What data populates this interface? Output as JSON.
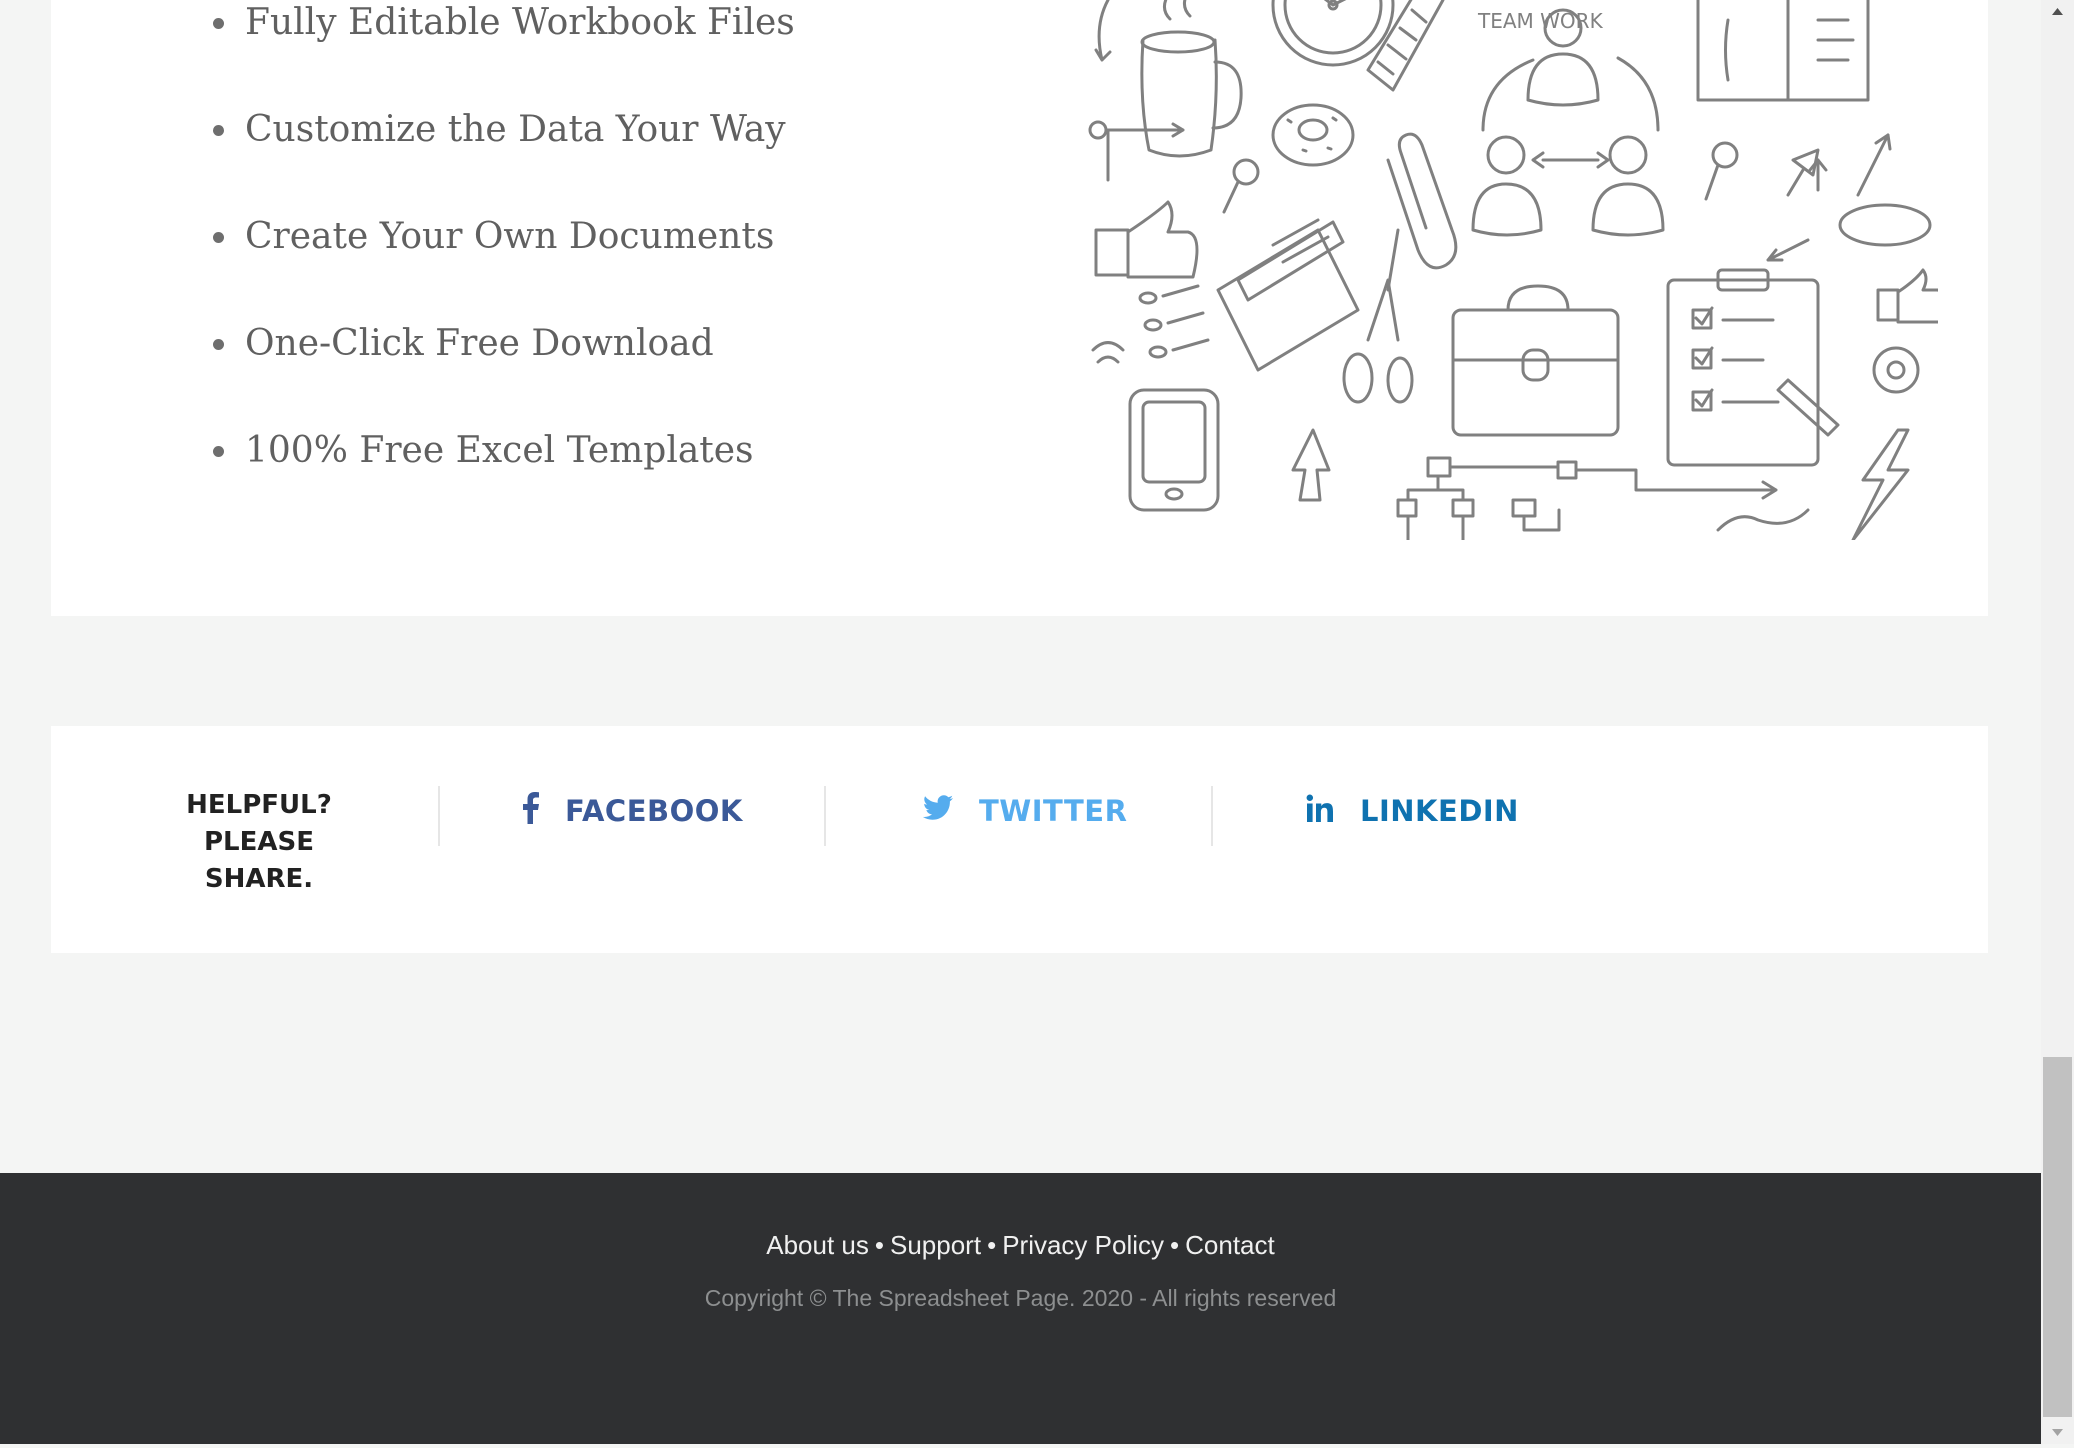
{
  "features": {
    "items": [
      "Fully Editable Workbook Files",
      "Customize the Data Your Way",
      "Create Your Own Documents",
      "One-Click Free Download",
      "100% Free Excel Templates"
    ],
    "illustration_text": "TEAM WORK"
  },
  "share": {
    "label_line1": "HELPFUL?",
    "label_line2": "PLEASE",
    "label_line3": "SHARE.",
    "buttons": [
      {
        "label": "FACEBOOK",
        "icon": "facebook-icon",
        "color": "#3b5998"
      },
      {
        "label": "TWITTER",
        "icon": "twitter-icon",
        "color": "#55acee"
      },
      {
        "label": "LINKEDIN",
        "icon": "linkedin-icon",
        "color": "#0f72b0"
      }
    ]
  },
  "footer": {
    "links": [
      "About us",
      "Support",
      "Privacy Policy",
      "Contact"
    ],
    "separator": "•",
    "copyright": "Copyright © The Spreadsheet Page. 2020 - All rights reserved",
    "background": "#2f3032"
  }
}
